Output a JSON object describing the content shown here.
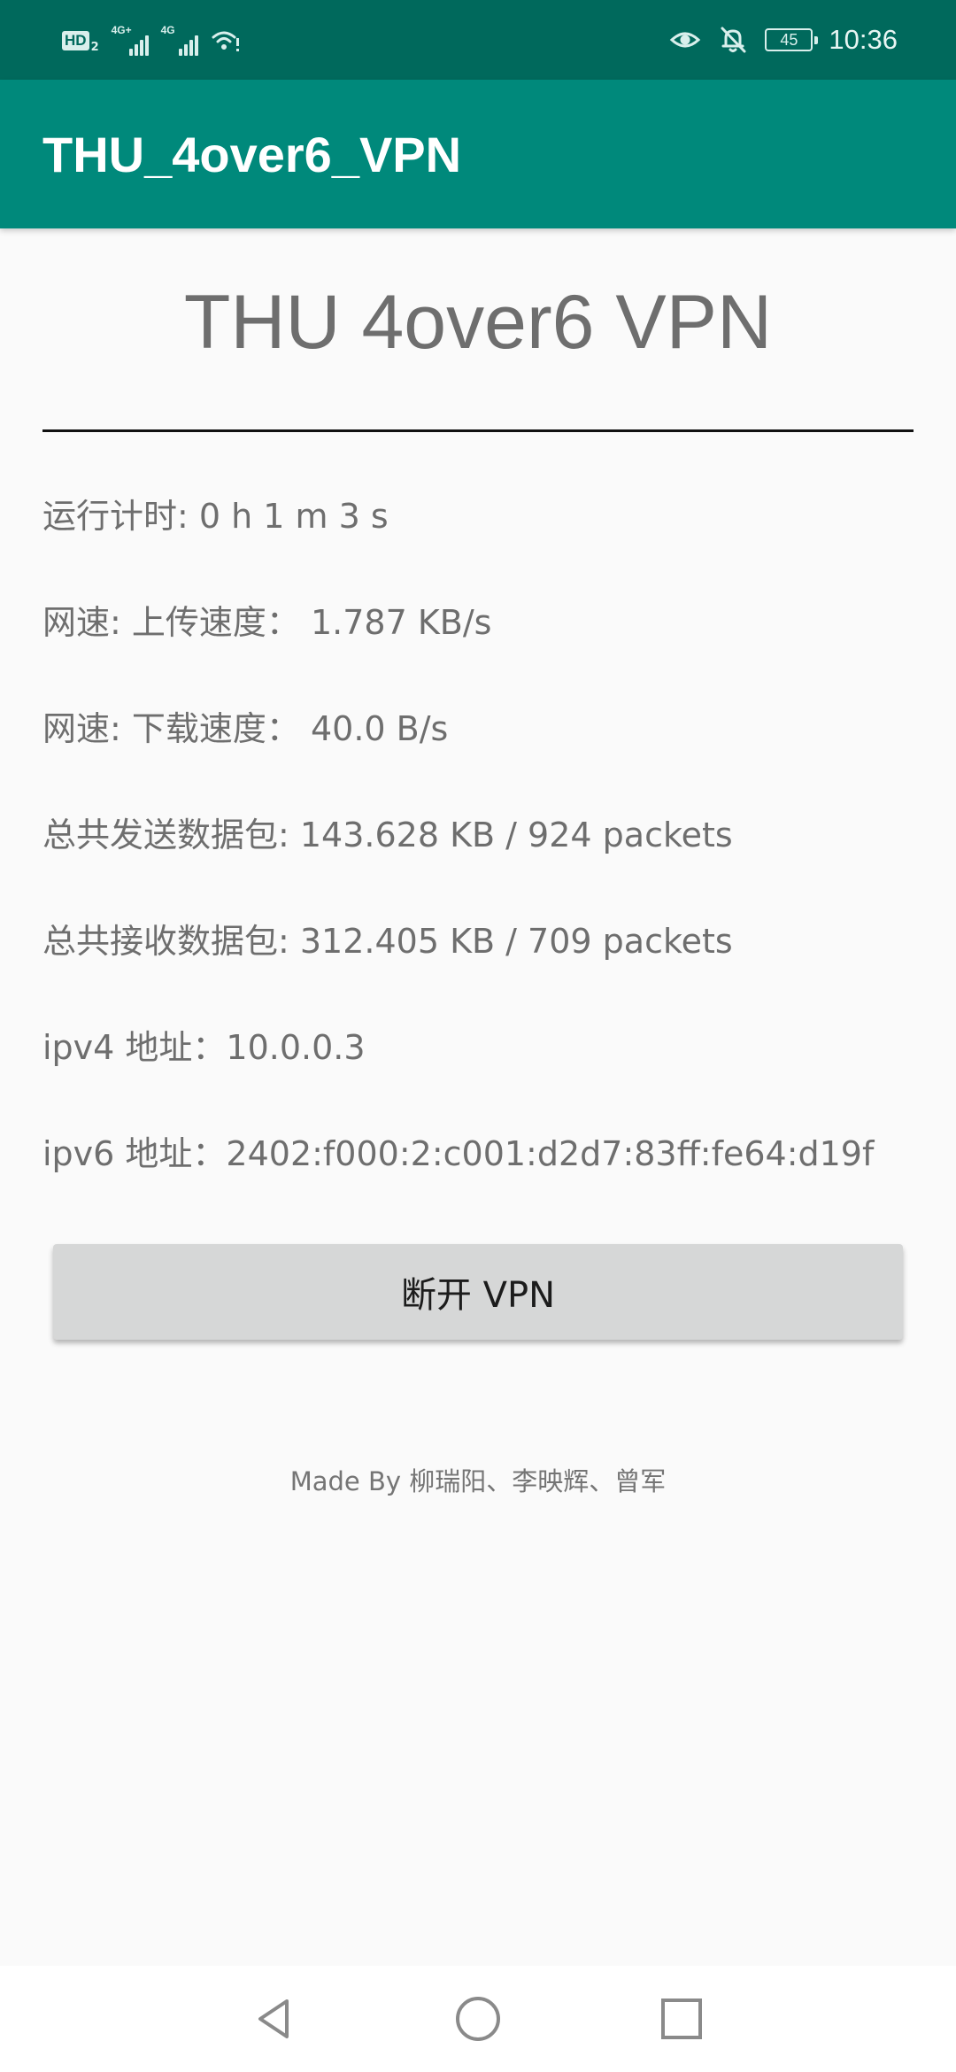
{
  "status_bar": {
    "hd_label": "HD",
    "hd_sub": "2",
    "signal_1_label": "4G+",
    "signal_2_label": "4G",
    "battery_level": "45",
    "time": "10:36",
    "icons": [
      "eye-icon",
      "mute-bell-icon",
      "wifi-icon",
      "battery-icon"
    ]
  },
  "app_bar": {
    "title": "THU_4over6_VPN"
  },
  "main": {
    "heading": "THU 4over6 VPN",
    "run_time": "运行计时: 0 h 1 m 3 s",
    "upload_speed": "网速: 上传速度： 1.787 KB/s",
    "download_speed": "网速: 下载速度：  40.0 B/s",
    "total_sent": "总共发送数据包: 143.628 KB / 924 packets",
    "total_received": "总共接收数据包: 312.405 KB / 709 packets",
    "ipv4_address": "ipv4 地址：10.0.0.3",
    "ipv6_address": "ipv6 地址：2402:f000:2:c001:d2d7:83ff:fe64:d19f",
    "disconnect_label": "断开 VPN",
    "credits": "Made By 柳瑞阳、李映辉、曾军"
  },
  "nav_bar": {
    "icons": [
      "back-icon",
      "home-icon",
      "recents-icon"
    ]
  },
  "colors": {
    "status_bar": "#00695c",
    "app_bar": "#00897b",
    "background": "#fafafa",
    "button": "#d6d7d7"
  }
}
